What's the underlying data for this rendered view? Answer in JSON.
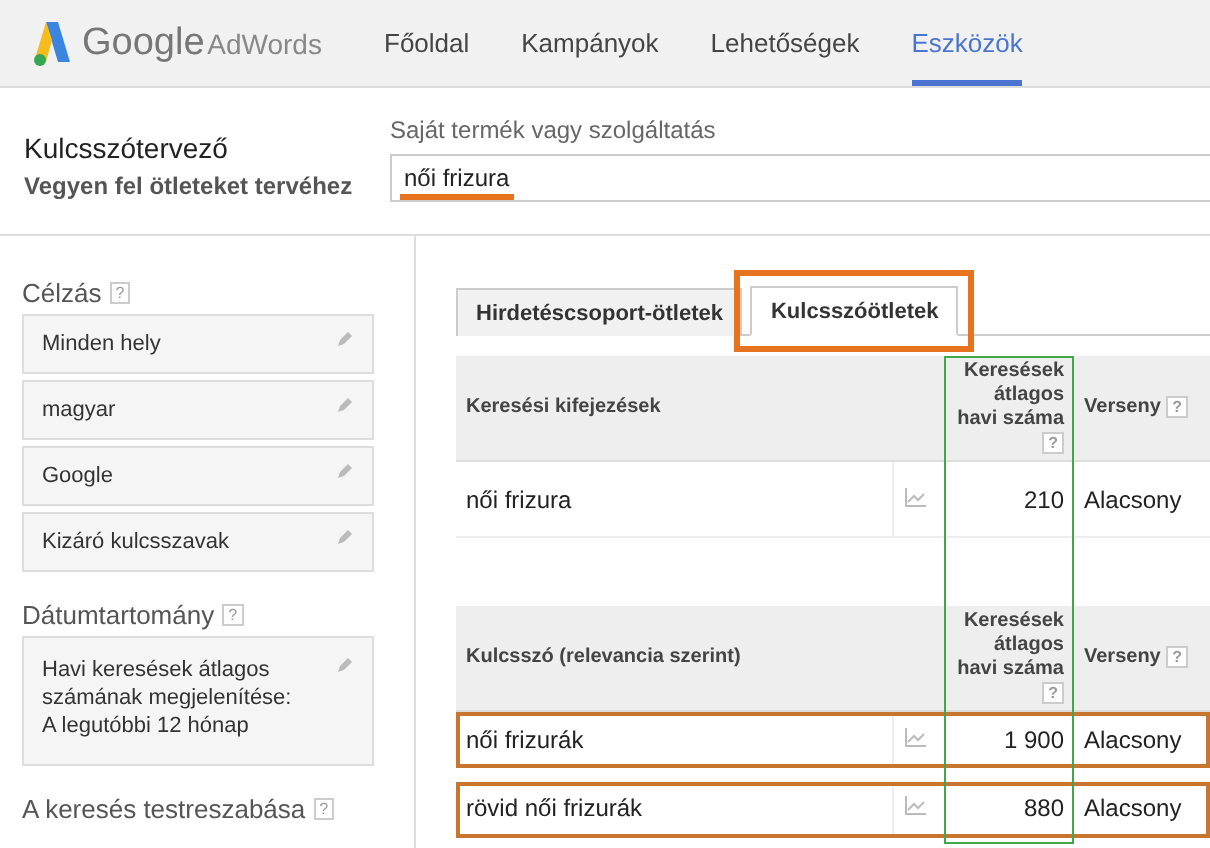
{
  "header": {
    "logo": {
      "brand": "Google",
      "product": "AdWords"
    },
    "nav": [
      {
        "label": "Főoldal",
        "selected": false
      },
      {
        "label": "Kampányok",
        "selected": false
      },
      {
        "label": "Lehetőségek",
        "selected": false
      },
      {
        "label": "Eszközök",
        "selected": true
      }
    ]
  },
  "page": {
    "title": "Kulcsszótervező",
    "subtitle": "Vegyen fel ötleteket tervéhez"
  },
  "product_field": {
    "label": "Saját termék vagy szolgáltatás",
    "value": "női frizura",
    "underlined": true
  },
  "sidebar": {
    "sections": [
      {
        "title": "Célzás",
        "help": "?",
        "items": [
          "Minden hely",
          "magyar",
          "Google",
          "Kizáró kulcsszavak"
        ]
      },
      {
        "title": "Dátumtartomány",
        "help": "?",
        "items": [
          "Havi keresések átlagos számának megjelenítése: A legutóbbi 12 hónap"
        ]
      },
      {
        "title": "A keresés testreszabása",
        "help": "?"
      }
    ]
  },
  "tabs": [
    {
      "label": "Hirdetéscsoport-ötletek",
      "selected": false,
      "highlighted": false
    },
    {
      "label": "Kulcsszóötletek",
      "selected": true,
      "highlighted": true
    }
  ],
  "searches_column_highlighted": true,
  "tables": [
    {
      "columns": [
        {
          "label": "Keresési kifejezések"
        },
        {
          "label": "Keresések átlagos havi száma",
          "help": "?"
        },
        {
          "label": "Verseny",
          "help": "?"
        }
      ],
      "rows": [
        {
          "keyword": "női frizura",
          "searches": "210",
          "competition": "Alacsony",
          "highlighted": false
        }
      ]
    },
    {
      "columns": [
        {
          "label": "Kulcsszó (relevancia szerint)"
        },
        {
          "label": "Keresések átlagos havi száma",
          "help": "?"
        },
        {
          "label": "Verseny",
          "help": "?"
        }
      ],
      "rows": [
        {
          "keyword": "női frizurák",
          "searches": "1 900",
          "competition": "Alacsony",
          "highlighted": true
        },
        {
          "keyword": "rövid női frizurák",
          "searches": "880",
          "competition": "Alacsony",
          "highlighted": true
        }
      ]
    }
  ]
}
